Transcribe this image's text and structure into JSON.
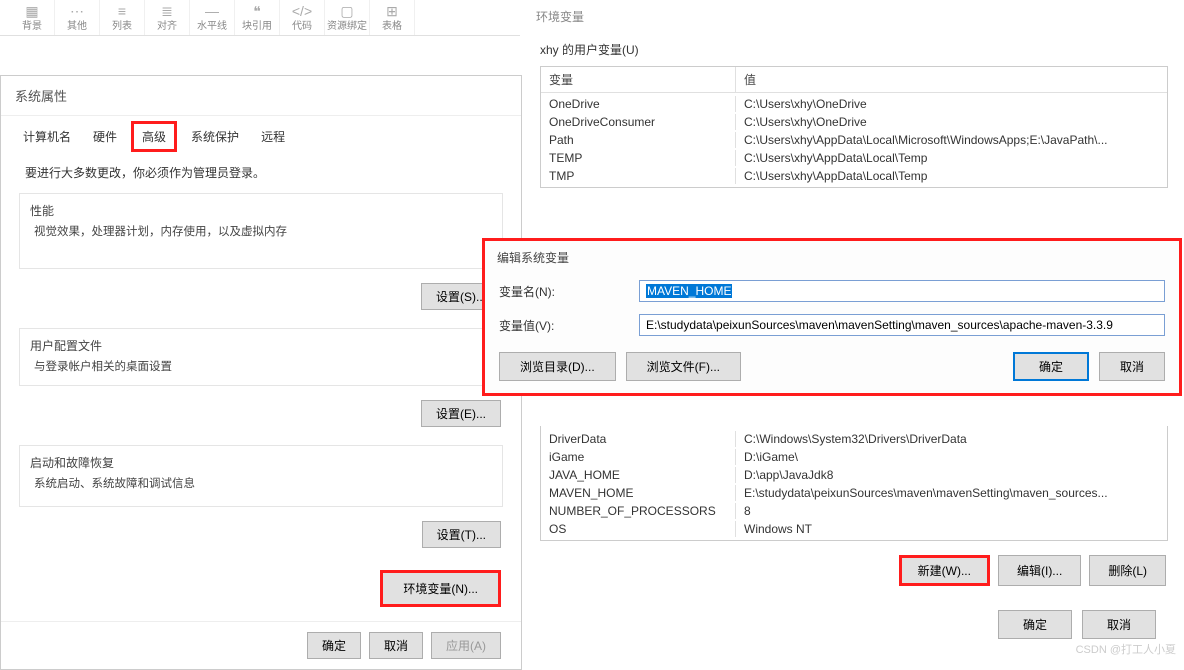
{
  "toolbar": [
    {
      "label": "背景"
    },
    {
      "label": "其他"
    },
    {
      "label": "列表"
    },
    {
      "label": "对齐"
    },
    {
      "label": "水平线"
    },
    {
      "label": "块引用"
    },
    {
      "label": "代码"
    },
    {
      "label": "资源绑定"
    },
    {
      "label": "表格"
    }
  ],
  "sysprops": {
    "title": "系统属性",
    "tabs": [
      "计算机名",
      "硬件",
      "高级",
      "系统保护",
      "远程"
    ],
    "admin_note": "要进行大多数更改，你必须作为管理员登录。",
    "perf": {
      "label": "性能",
      "desc": "视觉效果，处理器计划，内存使用，以及虚拟内存",
      "btn": "设置(S)..."
    },
    "profile": {
      "label": "用户配置文件",
      "desc": "与登录帐户相关的桌面设置",
      "btn": "设置(E)..."
    },
    "startup": {
      "label": "启动和故障恢复",
      "desc": "系统启动、系统故障和调试信息",
      "btn": "设置(T)..."
    },
    "envvar_btn": "环境变量(N)...",
    "ok": "确定",
    "cancel": "取消",
    "apply": "应用(A)"
  },
  "envpanel": {
    "title": "环境变量",
    "uservars_label": "xhy 的用户变量(U)",
    "header_name": "变量",
    "header_value": "值",
    "user_vars": [
      {
        "name": "OneDrive",
        "value": "C:\\Users\\xhy\\OneDrive"
      },
      {
        "name": "OneDriveConsumer",
        "value": "C:\\Users\\xhy\\OneDrive"
      },
      {
        "name": "Path",
        "value": "C:\\Users\\xhy\\AppData\\Local\\Microsoft\\WindowsApps;E:\\JavaPath\\..."
      },
      {
        "name": "TEMP",
        "value": "C:\\Users\\xhy\\AppData\\Local\\Temp"
      },
      {
        "name": "TMP",
        "value": "C:\\Users\\xhy\\AppData\\Local\\Temp"
      }
    ],
    "sys_vars": [
      {
        "name": "DriverData",
        "value": "C:\\Windows\\System32\\Drivers\\DriverData"
      },
      {
        "name": "iGame",
        "value": "D:\\iGame\\"
      },
      {
        "name": "JAVA_HOME",
        "value": "D:\\app\\JavaJdk8"
      },
      {
        "name": "MAVEN_HOME",
        "value": "E:\\studydata\\peixunSources\\maven\\mavenSetting\\maven_sources..."
      },
      {
        "name": "NUMBER_OF_PROCESSORS",
        "value": "8"
      },
      {
        "name": "OS",
        "value": "Windows NT"
      }
    ],
    "new_btn": "新建(W)...",
    "edit_btn": "编辑(I)...",
    "delete_btn": "删除(L)",
    "ok": "确定",
    "cancel": "取消"
  },
  "edit_dialog": {
    "title": "编辑系统变量",
    "name_label": "变量名(N):",
    "name_value": "MAVEN_HOME",
    "value_label": "变量值(V):",
    "value_value": "E:\\studydata\\peixunSources\\maven\\mavenSetting\\maven_sources\\apache-maven-3.3.9",
    "browse_dir": "浏览目录(D)...",
    "browse_file": "浏览文件(F)...",
    "ok": "确定",
    "cancel": "取消"
  },
  "watermark": "CSDN @打工人小夏"
}
